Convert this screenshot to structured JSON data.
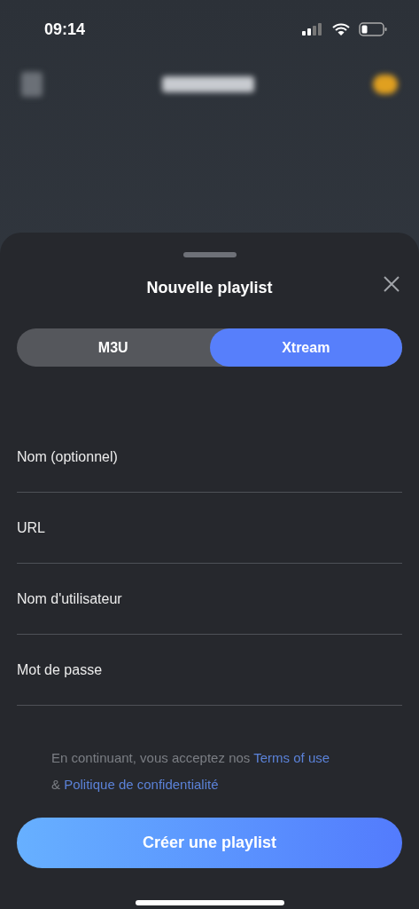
{
  "status_bar": {
    "time": "09:14"
  },
  "sheet": {
    "title": "Nouvelle playlist"
  },
  "tabs": [
    {
      "label": "M3U",
      "selected": false
    },
    {
      "label": "Xtream",
      "selected": true
    }
  ],
  "fields": [
    {
      "placeholder": "Nom (optionnel)"
    },
    {
      "placeholder": "URL"
    },
    {
      "placeholder": "Nom d'utilisateur"
    },
    {
      "placeholder": "Mot de passe"
    }
  ],
  "legal": {
    "text": "En continuant, vous acceptez nos",
    "terms_link": "Terms of use",
    "joiner": "&",
    "privacy_link": "Politique de confidentialité"
  },
  "create_button": "Créer une playlist"
}
